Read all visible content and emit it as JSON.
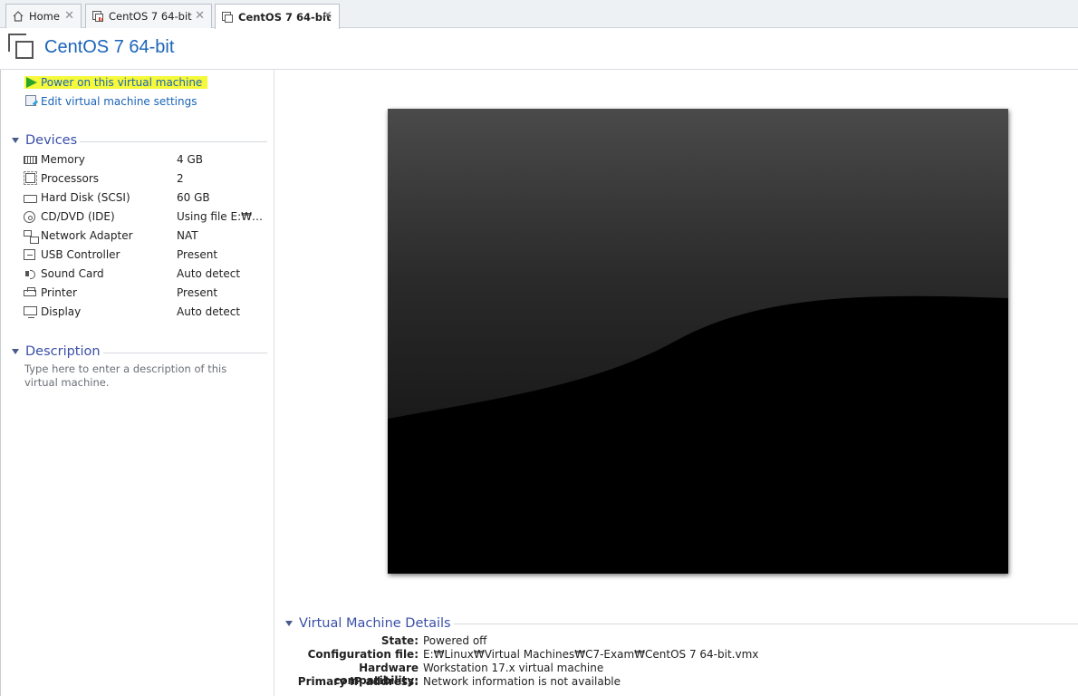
{
  "tabs": [
    {
      "label": "Home",
      "icon": "home-icon"
    },
    {
      "label": "CentOS 7 64-bit",
      "icon": "vm-tab-icon"
    },
    {
      "label": "CentOS 7 64-bit",
      "icon": "vm-tab-icon",
      "active": true
    }
  ],
  "header": {
    "title": "CentOS 7 64-bit"
  },
  "actions": {
    "power_on": "Power on this virtual machine",
    "edit_settings": "Edit virtual machine settings"
  },
  "devices": {
    "heading": "Devices",
    "items": [
      {
        "name": "Memory",
        "value": "4 GB",
        "icon": "memory-icon"
      },
      {
        "name": "Processors",
        "value": "2",
        "icon": "processor-icon"
      },
      {
        "name": "Hard Disk (SCSI)",
        "value": "60 GB",
        "icon": "hard-disk-icon"
      },
      {
        "name": "CD/DVD (IDE)",
        "value": "Using file E:₩Lin...",
        "icon": "cd-dvd-icon"
      },
      {
        "name": "Network Adapter",
        "value": "NAT",
        "icon": "network-adapter-icon"
      },
      {
        "name": "USB Controller",
        "value": "Present",
        "icon": "usb-controller-icon"
      },
      {
        "name": "Sound Card",
        "value": "Auto detect",
        "icon": "sound-card-icon"
      },
      {
        "name": "Printer",
        "value": "Present",
        "icon": "printer-icon"
      },
      {
        "name": "Display",
        "value": "Auto detect",
        "icon": "display-icon"
      }
    ]
  },
  "description": {
    "heading": "Description",
    "placeholder": "Type here to enter a description of this virtual machine."
  },
  "details": {
    "heading": "Virtual Machine Details",
    "rows": [
      {
        "label": "State:",
        "value": "Powered off"
      },
      {
        "label": "Configuration file:",
        "value": "E:₩Linux₩Virtual Machines₩C7-Exam₩CentOS 7 64-bit.vmx"
      },
      {
        "label": "Hardware compatibility:",
        "value": "Workstation 17.x virtual machine"
      },
      {
        "label": "Primary IP address:",
        "value": "Network information is not available"
      }
    ]
  },
  "colors": {
    "accent": "#1a64b8",
    "section": "#3a4fa8",
    "highlight": "#f6f93a",
    "play": "#2aa52a"
  }
}
